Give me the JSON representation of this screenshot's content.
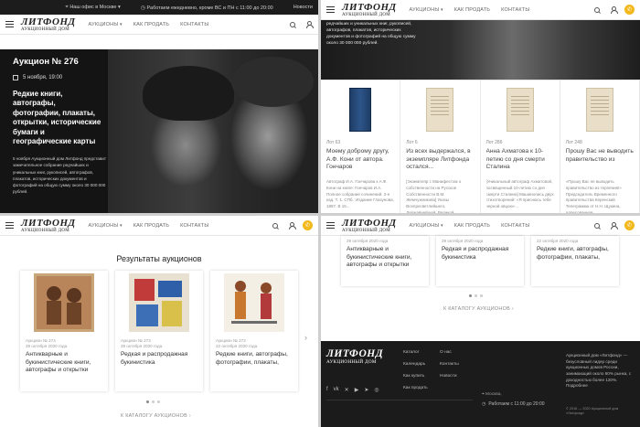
{
  "topbar": {
    "office": "Наш офис в Москве",
    "hours": "Работаем ежедневно, кроме ВС и ПН с 11:00 до 20:00",
    "news": "Новости"
  },
  "logo": {
    "line1": "ЛИТФОНД",
    "line2": "АУКЦИОННЫЙ ДОМ"
  },
  "nav": {
    "auctions": "АУКЦИОНЫ",
    "how_to_sell": "КАК ПРОДАТЬ",
    "contacts": "КОНТАКТЫ"
  },
  "hero": {
    "title": "Аукцион № 276",
    "date": "5 ноября, 19:00",
    "headline": "Редкие книги, автографы, фотографии, плакаты, открытки, исторические бумаги и географические карты",
    "description": "5 ноября Аукционный дом Литфонд представит замечательное собрание редчайших и уникальных книг, рукописей, автографов, плакатов, исторических документов и фотографий на общую сумму около 30 000 000 рублей."
  },
  "panel2_intro": "редчайших и уникальных книг, рукописей, автографов, плакатов, исторических документов и фотографий на общую сумму около 30 000 000 рублей.",
  "lots": [
    {
      "no": "Лот 63",
      "title": "Моему доброму другу, А.Ф. Кони от автора. Гончаров",
      "desc": "Автограф И.А. Гончарова к А.Ф. Кони на книге: Гончаров И.А. Полное собрание сочинений. 2-е изд. Т. 1. СПб.: Издание Глазунова, 1887. В 15..."
    },
    {
      "no": "Лот 6",
      "title": "Из всех выдержался, в экземпляре Литфонда остался...",
      "desc": "[Экземпляр с Манифестом о собственности на Русское Собственности В.М. Жемчужникова] Указы Всепресветлейшего, Державнейшей, Великой..."
    },
    {
      "no": "Лот 286",
      "title": "Анна Ахматова к 10-летию со дня смерти Сталина",
      "desc": "[Уникальный автограф Ахматовой, посвященный 10-летию со дня смерти Сталина] Машинопись двух стихотворений: «Я приснюсь тебе черной овцою»..."
    },
    {
      "no": "Лот 248",
      "title": "Прошу Вас не выводить правительство из",
      "desc": "«Прошу Вас не выводить правительство из терпения!» Председатель Временного правительства Керенский Телеграмма от Н.Н. Щукина, адресованная..."
    }
  ],
  "results": {
    "title": "Результаты аукционов",
    "cards": [
      {
        "auction": "Аукцион № 274",
        "date": "29 октября 2020 года",
        "name": "Антикварные и букинистические книги, автографы и открытки"
      },
      {
        "auction": "Аукцион № 273",
        "date": "29 октября 2020 года",
        "name": "Редкая и распродажная букинистика"
      },
      {
        "auction": "Аукцион № 272",
        "date": "22 октября 2020 года",
        "name": "Редкие книги, автографы, фотографии, плакаты,"
      }
    ],
    "catalog_link": "К КАТАЛОГУ АУКЦИОНОВ"
  },
  "panel4_cards": [
    {
      "date": "29 октября 2020 года",
      "name": "Антикварные и букинистические книги, автографы и открытки"
    },
    {
      "date": "29 октября 2020 года",
      "name": "Редкая и распродажная букинистика"
    },
    {
      "date": "22 октября 2020 года",
      "name": "Редкие книги, автографы, фотографии, плакаты,"
    }
  ],
  "footer": {
    "col1": [
      "Каталог",
      "Календарь",
      "Как купить",
      "Как продать"
    ],
    "col2": [
      "О нас",
      "Контакты",
      "Новости"
    ],
    "address": "Москва,",
    "hours": "Работаем с 11:00 до 20:00",
    "info": "Аукционный дом «Литфонд» — безусловный лидер среди аукционных домов России, занимающий около 60% рынка, с доходностью более 120%. Подробнее",
    "copyright": "© 2016 — 2020 Аукционный дом «Литфонд»"
  },
  "colors": {
    "accent": "#f2b81c",
    "dark": "#1b1b1b"
  }
}
